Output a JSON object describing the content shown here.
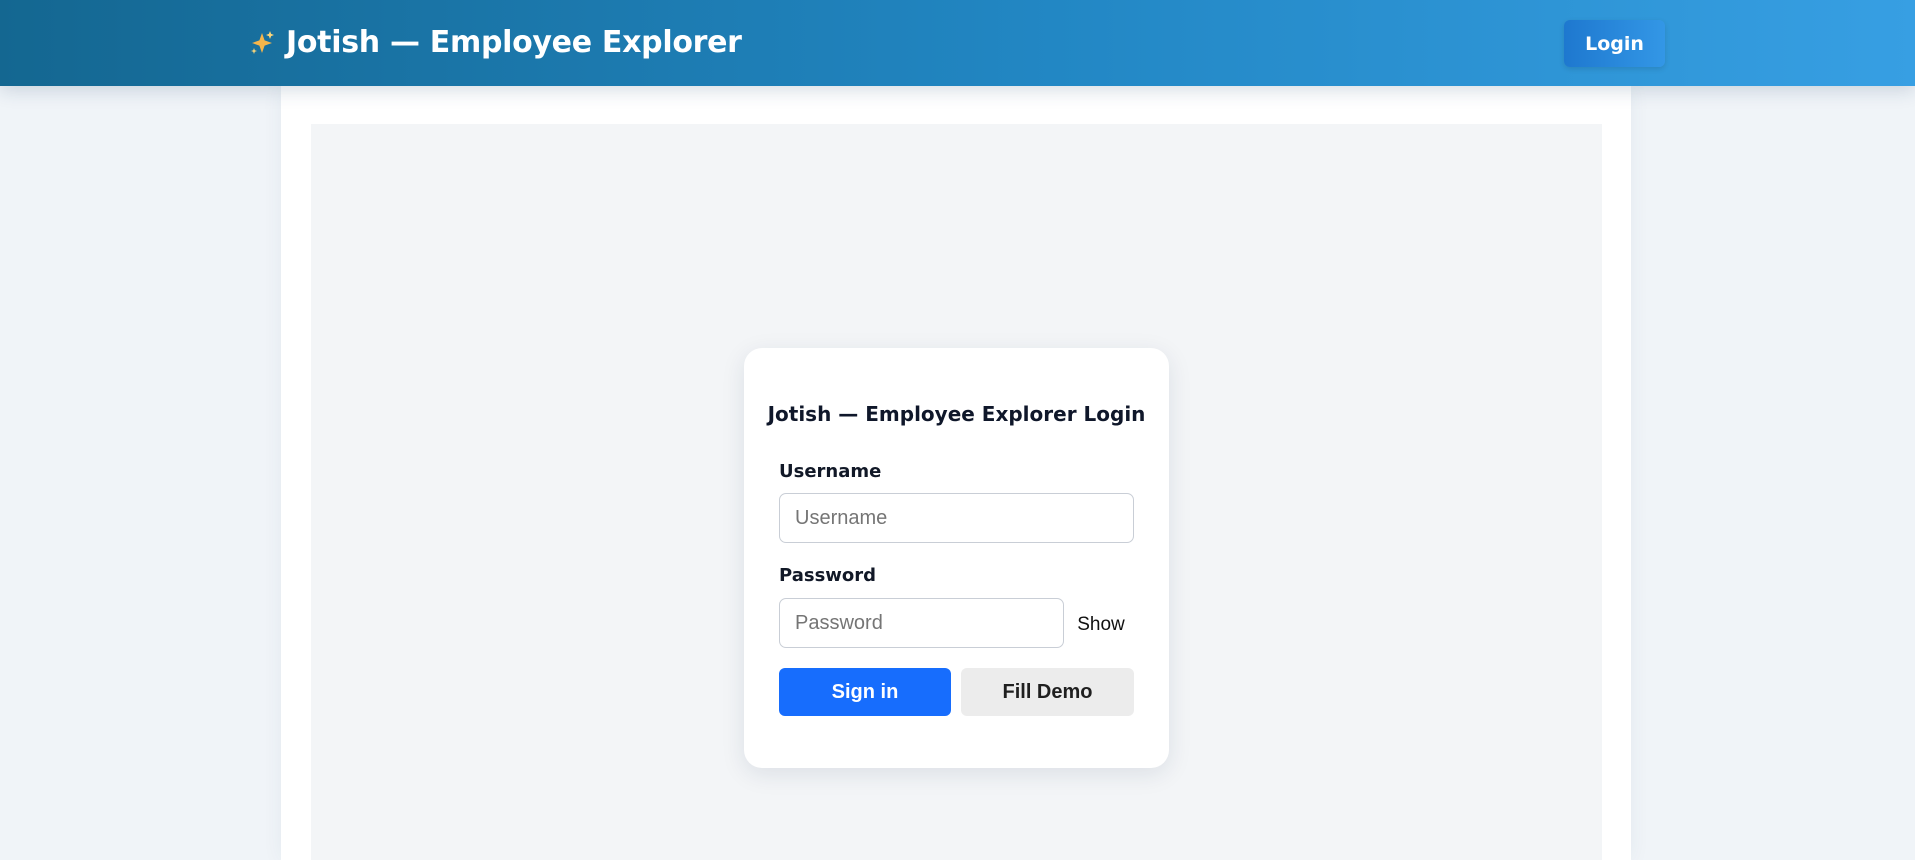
{
  "header": {
    "brand_icon": "sparkles-icon",
    "title": "Jotish — Employee Explorer",
    "login_label": "Login"
  },
  "login_form": {
    "title": "Jotish — Employee Explorer Login",
    "username": {
      "label": "Username",
      "placeholder": "Username",
      "value": ""
    },
    "password": {
      "label": "Password",
      "placeholder": "Password",
      "value": "",
      "toggle_label": "Show"
    },
    "sign_in_label": "Sign in",
    "fill_demo_label": "Fill Demo"
  },
  "colors": {
    "header_gradient_start": "#146791",
    "header_gradient_end": "#379fe3",
    "primary_button": "#176dfd",
    "secondary_button": "#ececec",
    "page_background": "#f0f4f8"
  }
}
